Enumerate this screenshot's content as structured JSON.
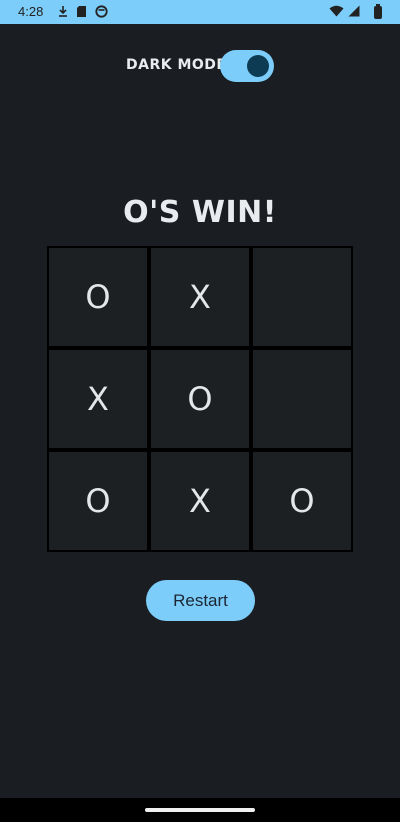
{
  "status_bar": {
    "time": "4:28",
    "left_icons": [
      "download-icon",
      "sd-card-icon",
      "vpn-icon"
    ],
    "right_icons": [
      "wifi-icon",
      "signal-icon",
      "battery-icon"
    ],
    "background": "#7ccdfa"
  },
  "dark_mode": {
    "label": "DARK MODE",
    "enabled": true
  },
  "game": {
    "result": "O'S WIN!",
    "board": [
      [
        "O",
        "X",
        ""
      ],
      [
        "X",
        "O",
        ""
      ],
      [
        "O",
        "X",
        "O"
      ]
    ]
  },
  "restart": {
    "label": "Restart"
  },
  "colors": {
    "background": "#1a1e22",
    "accent": "#7ccdfa",
    "text": "#e9ecef",
    "grid_line": "#000000"
  }
}
